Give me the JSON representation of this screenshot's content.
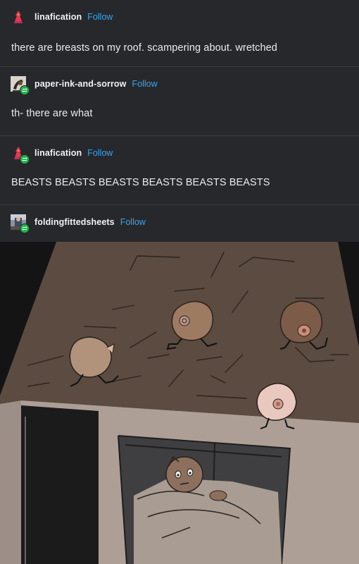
{
  "posts": [
    {
      "username": "linafication",
      "follow_label": "Follow",
      "text": "there are breasts on my roof. scampering about. wretched",
      "avatar_icon": "red-figure-avatar-icon",
      "reblog": false
    },
    {
      "username": "paper-ink-and-sorrow",
      "follow_label": "Follow",
      "text": "th- there are what",
      "avatar_icon": "sketch-avatar-icon",
      "reblog": true
    },
    {
      "username": "linafication",
      "follow_label": "Follow",
      "text": "BEASTS BEASTS BEASTS BEASTS BEASTS BEASTS",
      "avatar_icon": "red-figure-avatar-icon",
      "reblog": true
    },
    {
      "username": "foldingfittedsheets",
      "follow_label": "Follow",
      "avatar_icon": "photo-avatar-icon",
      "reblog": true
    }
  ],
  "colors": {
    "background": "#26282c",
    "follow_link": "#3aa6ef",
    "reblog_badge": "#1bb54b",
    "roof": "#5a4a3f",
    "wall": "#ab9d93"
  },
  "image": {
    "icon": "comic-drawing-image"
  }
}
